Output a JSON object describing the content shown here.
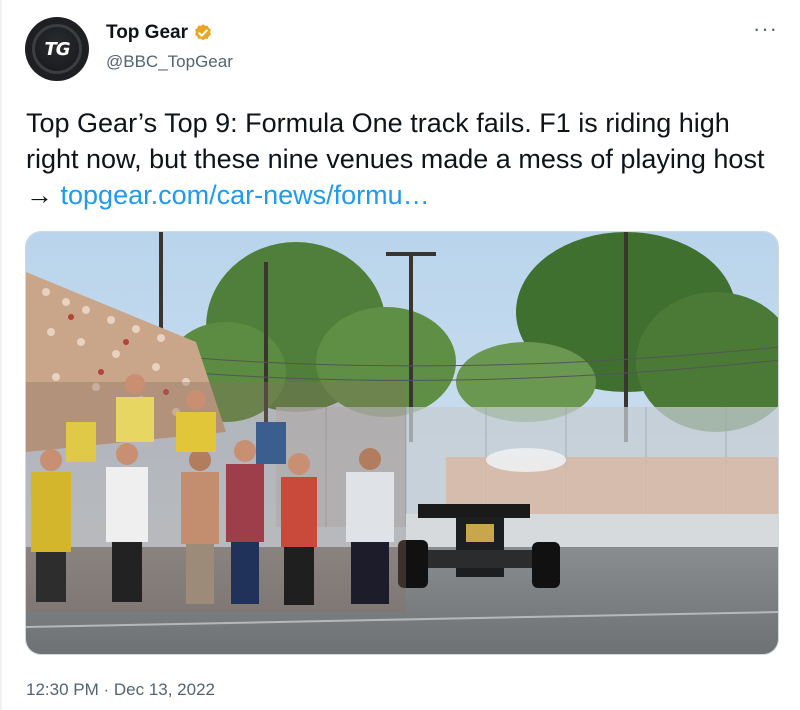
{
  "account": {
    "display_name": "Top Gear",
    "handle": "@BBC_TopGear",
    "avatar_text": "TG",
    "verified_color": "#e9a524"
  },
  "tweet": {
    "text": "Top Gear’s Top 9: Formula One track fails. F1 is riding high right now, but these nine venues made a mess of playing host → ",
    "link_text": "topgear.com/car-news/formu…",
    "timestamp": "12:30 PM · Dec 13, 2022"
  },
  "more_label": "···",
  "colors": {
    "link": "#1d9bf0",
    "muted": "#536471",
    "text": "#0f1419"
  }
}
